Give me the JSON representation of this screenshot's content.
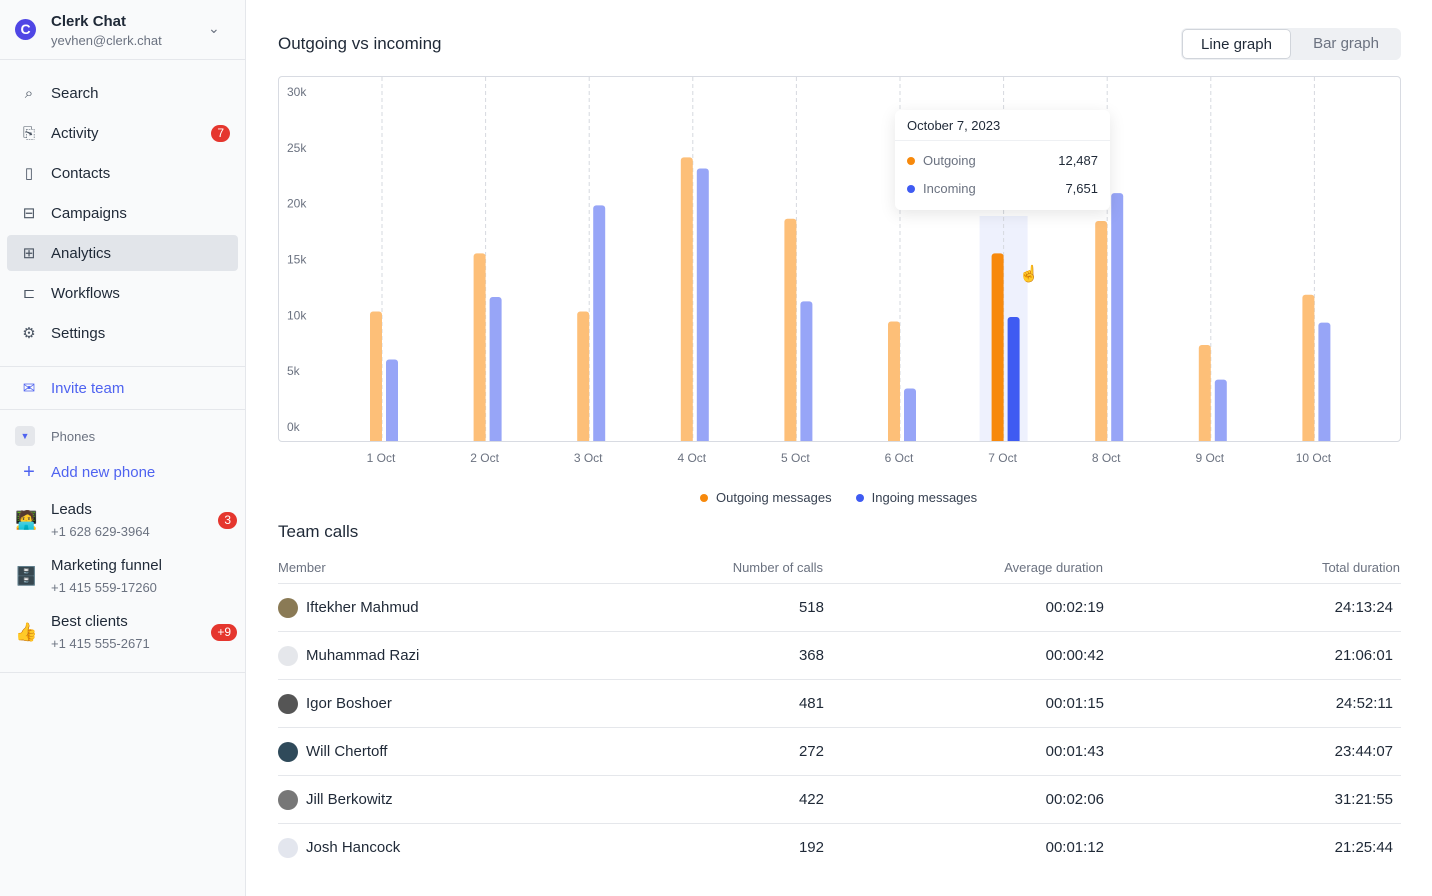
{
  "workspace": {
    "name": "Clerk Chat",
    "email": "yevhen@clerk.chat",
    "logo": "C"
  },
  "nav": [
    {
      "label": "Search",
      "icon": "search-icon",
      "glyph": "⌕"
    },
    {
      "label": "Activity",
      "icon": "mailbox-icon",
      "glyph": "⎘",
      "badge": "7"
    },
    {
      "label": "Contacts",
      "icon": "contact-book-icon",
      "glyph": "▯"
    },
    {
      "label": "Campaigns",
      "icon": "inbox-icon",
      "glyph": "⊟"
    },
    {
      "label": "Analytics",
      "icon": "presentation-icon",
      "glyph": "⊞",
      "active": true
    },
    {
      "label": "Workflows",
      "icon": "workflow-icon",
      "glyph": "⊏"
    },
    {
      "label": "Settings",
      "icon": "gear-icon",
      "glyph": "⚙"
    }
  ],
  "invite": "Invite team",
  "phones": {
    "label": "Phones",
    "add": "Add new phone",
    "items": [
      {
        "name": "Leads",
        "number": "+1 628 629-3964",
        "emoji": "🧑‍💻",
        "badge": "3"
      },
      {
        "name": "Marketing funnel",
        "number": "+1 415 559-17260",
        "emoji": "🗄️"
      },
      {
        "name": "Best clients",
        "number": "+1 415 555-2671",
        "emoji": "👍",
        "badge": "+9"
      }
    ]
  },
  "main": {
    "title": "Outgoing vs incoming",
    "toggle": [
      "Line graph",
      "Bar graph"
    ],
    "selected_toggle": "Line graph"
  },
  "colors": {
    "outgoing": "#fdbf78",
    "outgoing_active": "#f7890c",
    "incoming": "#97a5f7",
    "incoming_active": "#3f5bf2"
  },
  "chart_data": {
    "type": "bar",
    "categories": [
      "1 Oct",
      "2 Oct",
      "3 Oct",
      "4 Oct",
      "5 Oct",
      "6 Oct",
      "7 Oct",
      "8 Oct",
      "9 Oct",
      "10 Oct"
    ],
    "yticks": [
      "0k",
      "5k",
      "10k",
      "15k",
      "20k",
      "25k",
      "30k"
    ],
    "ylim": [
      0,
      30000
    ],
    "series": [
      {
        "name": "Outgoing messages",
        "values": [
          11600,
          16800,
          11600,
          25400,
          19900,
          10700,
          16800,
          19700,
          8600,
          13100
        ]
      },
      {
        "name": "Ingoing messages",
        "values": [
          7300,
          12900,
          21100,
          24400,
          12500,
          4700,
          11100,
          22200,
          5500,
          10600
        ]
      }
    ],
    "highlighted": "7 Oct",
    "grid": "vertical dashed",
    "legend": "bottom"
  },
  "tooltip": {
    "date": "October 7, 2023",
    "rows": [
      {
        "label": "Outgoing",
        "value": "12,487"
      },
      {
        "label": "Incoming",
        "value": "7,651"
      }
    ]
  },
  "team": {
    "title": "Team calls",
    "headers": [
      "Member",
      "Number of calls",
      "Average duration",
      "Total duration"
    ],
    "rows": [
      {
        "name": "Iftekher Mahmud",
        "calls": "518",
        "avg": "00:02:19",
        "total": "24:13:24",
        "color": "#8a7a55"
      },
      {
        "name": "Muhammad Razi",
        "calls": "368",
        "avg": "00:00:42",
        "total": "21:06:01",
        "color": "#e5e7eb"
      },
      {
        "name": "Igor Boshoer",
        "calls": "481",
        "avg": "00:01:15",
        "total": "24:52:11",
        "color": "#555"
      },
      {
        "name": "Will Chertoff",
        "calls": "272",
        "avg": "00:01:43",
        "total": "23:44:07",
        "color": "#2f4a5a"
      },
      {
        "name": "Jill Berkowitz",
        "calls": "422",
        "avg": "00:02:06",
        "total": "31:21:55",
        "color": "#777"
      },
      {
        "name": "Josh Hancock",
        "calls": "192",
        "avg": "00:01:12",
        "total": "21:25:44",
        "color": "#e3e6ee"
      }
    ]
  }
}
